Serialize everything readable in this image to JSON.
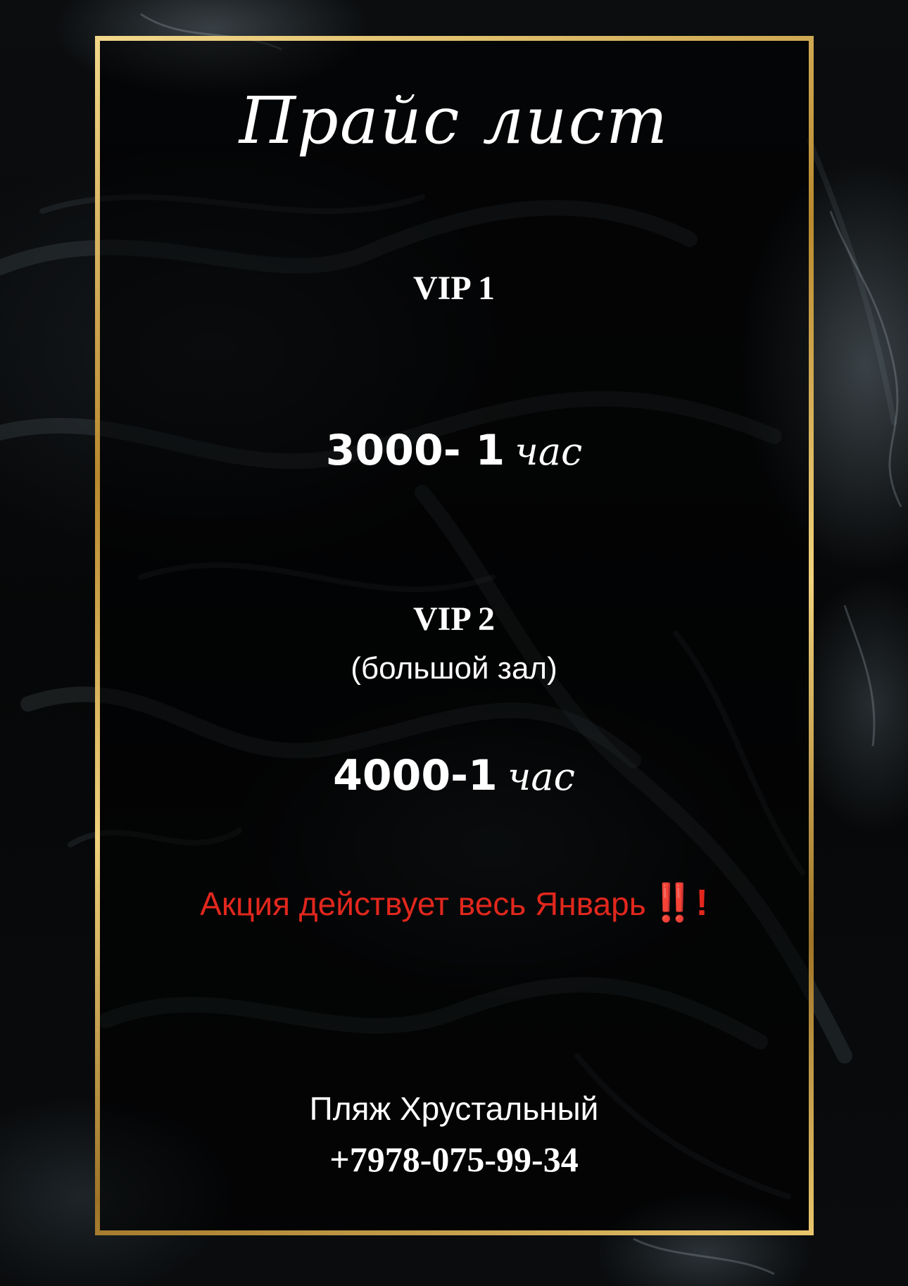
{
  "title": "Прайс лист",
  "vip1": {
    "label": "VIP 1",
    "price": "3000- 1",
    "unit": "час"
  },
  "vip2": {
    "label": "VIP 2",
    "subtitle": "(большой зал)",
    "price": "4000-1",
    "unit": "час"
  },
  "promo": {
    "text": "Акция действует весь Январь",
    "marks": "‼️!"
  },
  "footer": {
    "place": "Пляж Хрустальный",
    "phone": "+7978-075-99-34"
  },
  "colors": {
    "frame_gold": "#c9a24a",
    "promo_red": "#e1271d",
    "text_white": "#ffffff",
    "background": "#050607"
  }
}
